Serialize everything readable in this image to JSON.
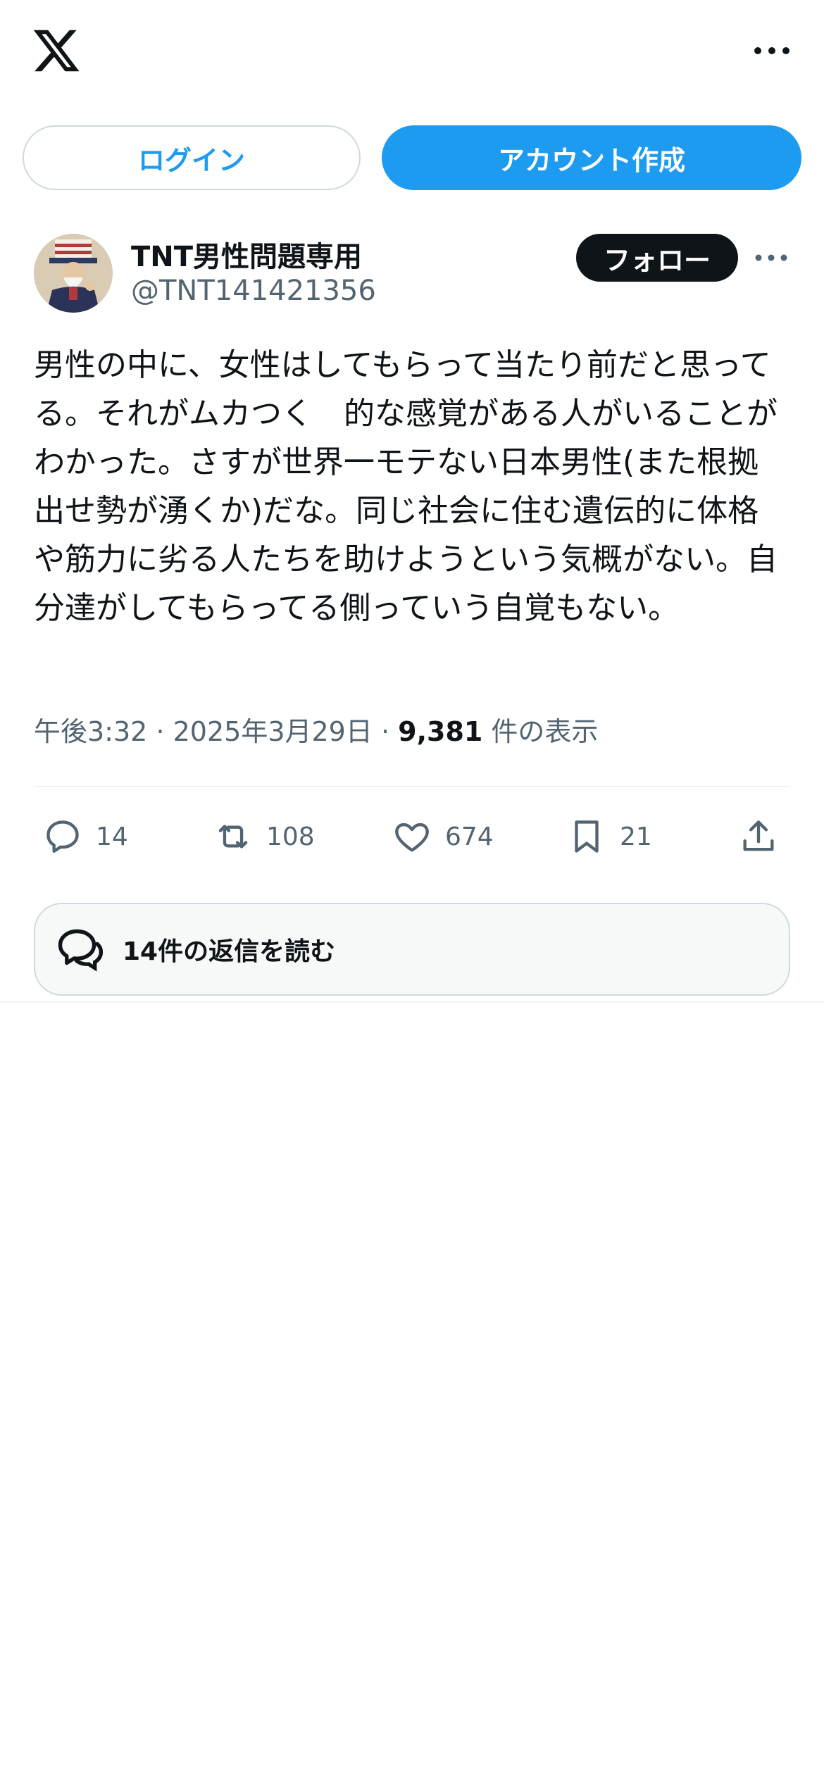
{
  "header": {
    "logo_icon": "x-logo-icon",
    "more_icon": "more-horizontal-icon"
  },
  "auth": {
    "login_label": "ログイン",
    "signup_label": "アカウント作成"
  },
  "author": {
    "name": "TNT男性問題専用",
    "handle": "@TNT141421356",
    "follow_label": "フォロー",
    "avatar_icon": "avatar-image"
  },
  "tweet": {
    "text": "男性の中に、女性はしてもらって当たり前だと思ってる。それがムカつく　的な感覚がある人がいることがわかった。さすが世界一モテない日本男性(また根拠出せ勢が湧くか)だな。同じ社会に住む遺伝的に体格や筋力に劣る人たちを助けようという気概がない。自分達がしてもらってる側っていう自覚もない。",
    "time": "午後3:32",
    "date": "2025年3月29日",
    "views_count": "9,381",
    "views_label": "件の表示"
  },
  "actions": {
    "reply_count": "14",
    "retweet_count": "108",
    "like_count": "674",
    "bookmark_count": "21"
  },
  "replies_label": "14件の返信を読む",
  "colors": {
    "accent": "#1d9bf0",
    "text": "#0f1419",
    "muted": "#536471"
  }
}
